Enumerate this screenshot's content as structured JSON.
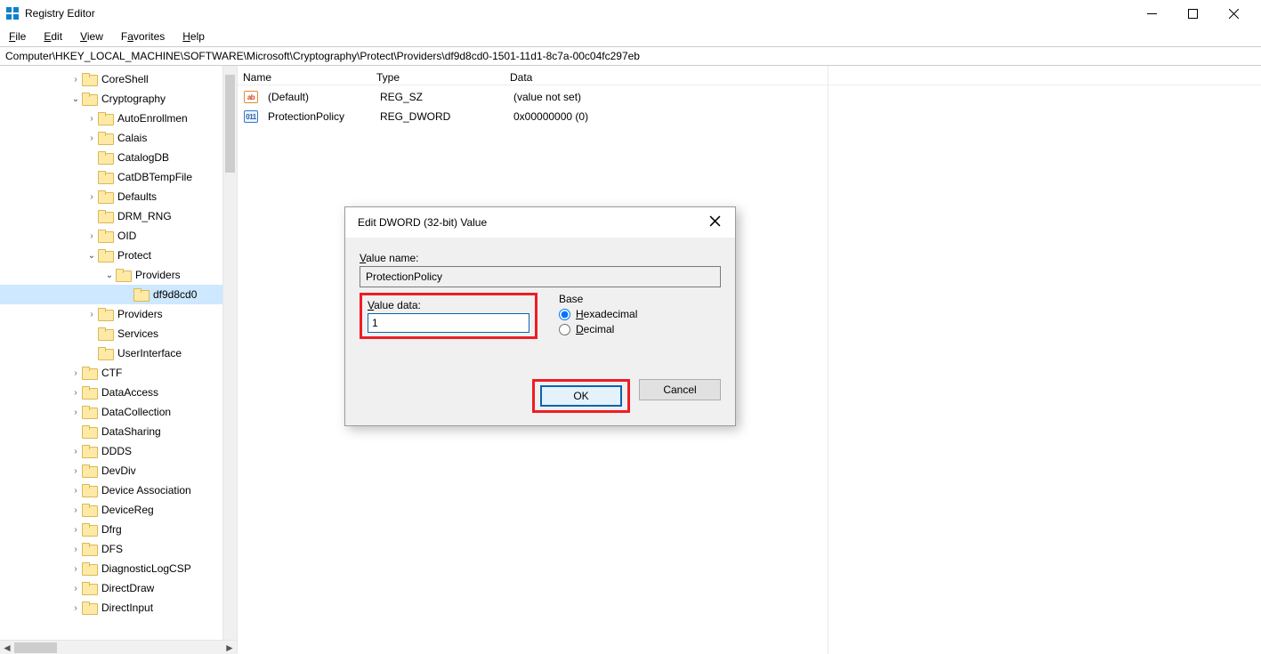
{
  "app": {
    "title": "Registry Editor"
  },
  "menu": {
    "file": "File",
    "edit": "Edit",
    "view": "View",
    "favorites": "Favorites",
    "help": "Help"
  },
  "address": "Computer\\HKEY_LOCAL_MACHINE\\SOFTWARE\\Microsoft\\Cryptography\\Protect\\Providers\\df9d8cd0-1501-11d1-8c7a-00c04fc297eb",
  "tree": {
    "n0": "CoreShell",
    "n1": "Cryptography",
    "n2": "AutoEnrollmen",
    "n3": "Calais",
    "n4": "CatalogDB",
    "n5": "CatDBTempFile",
    "n6": "Defaults",
    "n7": "DRM_RNG",
    "n8": "OID",
    "n9": "Protect",
    "n10": "Providers",
    "n11": "df9d8cd0",
    "n12": "Providers",
    "n13": "Services",
    "n14": "UserInterface",
    "n15": "CTF",
    "n16": "DataAccess",
    "n17": "DataCollection",
    "n18": "DataSharing",
    "n19": "DDDS",
    "n20": "DevDiv",
    "n21": "Device Association",
    "n22": "DeviceReg",
    "n23": "Dfrg",
    "n24": "DFS",
    "n25": "DiagnosticLogCSP",
    "n26": "DirectDraw",
    "n27": "DirectInput"
  },
  "list": {
    "col_name": "Name",
    "col_type": "Type",
    "col_data": "Data",
    "r0": {
      "name": "(Default)",
      "type": "REG_SZ",
      "data": "(value not set)"
    },
    "r1": {
      "name": "ProtectionPolicy",
      "type": "REG_DWORD",
      "data": "0x00000000 (0)"
    }
  },
  "dialog": {
    "title": "Edit DWORD (32-bit) Value",
    "value_name_label": "Value name:",
    "value_name": "ProtectionPolicy",
    "value_data_label": "Value data:",
    "value_data": "1",
    "base_label": "Base",
    "hex_label": "Hexadecimal",
    "dec_label": "Decimal",
    "ok": "OK",
    "cancel": "Cancel"
  }
}
